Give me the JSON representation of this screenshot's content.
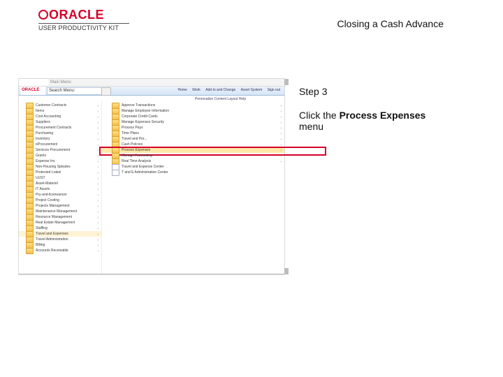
{
  "header": {
    "brand": "ORACLE",
    "subbrand": "USER PRODUCTIVITY KIT",
    "doc_title": "Closing a Cash Advance"
  },
  "instruction": {
    "step_label": "Step 3",
    "pre": "Click the ",
    "bold": "Process Expenses",
    "post": " menu"
  },
  "shot": {
    "topbar_tab": "Main Menu",
    "hdr_logo": "ORACLE",
    "search_label": "Search Menu:",
    "nav": [
      "Home",
      "Work",
      "Add to and Change",
      "Asset System",
      "Sign out"
    ],
    "subheader": "Personalize Content  Layout    Help",
    "col1": [
      {
        "lbl": "Customer Contracts",
        "car": "›"
      },
      {
        "lbl": "Items",
        "car": "›"
      },
      {
        "lbl": "Cost Accounting",
        "car": "›"
      },
      {
        "lbl": "Suppliers",
        "car": "›"
      },
      {
        "lbl": "Procurement Contracts",
        "car": "›"
      },
      {
        "lbl": "Purchasing",
        "car": "›"
      },
      {
        "lbl": "Inventory",
        "car": "›"
      },
      {
        "lbl": "eProcurement",
        "car": "›"
      },
      {
        "lbl": "Services Procurement",
        "car": "›"
      },
      {
        "lbl": "Grants",
        "car": "›"
      },
      {
        "lbl": "Expense Ins",
        "car": "›"
      },
      {
        "lbl": "Non-Housing Spksdes",
        "car": "›"
      },
      {
        "lbl": "Protected Lrakel",
        "car": "›"
      },
      {
        "lbl": "UUST",
        "car": "›"
      },
      {
        "lbl": "Asset-Materiel",
        "car": "›"
      },
      {
        "lbl": "IT Assets",
        "car": "›"
      },
      {
        "lbl": "Pry-and-liceneancer",
        "car": "›"
      },
      {
        "lbl": "Project Costing",
        "car": "›"
      },
      {
        "lbl": "Projects Management",
        "car": "›"
      },
      {
        "lbl": "Maintenance Management",
        "car": "›"
      },
      {
        "lbl": "Resource Management",
        "car": "›"
      },
      {
        "lbl": "Real Estate Management",
        "car": "›"
      },
      {
        "lbl": "Staffing",
        "car": "›"
      },
      {
        "lbl": "Travel and Expenses",
        "car": "›",
        "curr": true
      },
      {
        "lbl": "Travel Administration",
        "car": "›"
      },
      {
        "lbl": "Billing",
        "car": "›"
      },
      {
        "lbl": "Accounts Receivable",
        "car": "›"
      }
    ],
    "col2": [
      {
        "lbl": "Approve Transactions",
        "car": "›"
      },
      {
        "lbl": "Manage Employee Information",
        "car": "›"
      },
      {
        "lbl": "Corporate Credit Cards",
        "car": "›"
      },
      {
        "lbl": "Manage Expenses Security",
        "car": "›"
      },
      {
        "lbl": "Process Pays",
        "car": "›"
      },
      {
        "lbl": "Time Plans",
        "car": "›"
      },
      {
        "lbl": "Travel and Per...",
        "car": "›"
      },
      {
        "lbl": "Cash Policies",
        "car": "›"
      },
      {
        "lbl": "Process Expenses",
        "car": "›",
        "hl": true,
        "red": true
      },
      {
        "lbl": "Manage Accounting",
        "car": "›"
      },
      {
        "lbl": "Real Time Analysis",
        "car": "›"
      },
      {
        "lbl": "Travel and Expense Center",
        "pg": true
      },
      {
        "lbl": "T and E Administration Center",
        "pg": true
      }
    ]
  }
}
